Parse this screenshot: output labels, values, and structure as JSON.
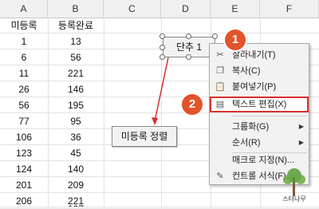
{
  "columns": [
    "A",
    "B",
    "C",
    "D",
    "E",
    "F"
  ],
  "rows": [
    {
      "a": "미등록",
      "b": "등록완료"
    },
    {
      "a": "1",
      "b": "13"
    },
    {
      "a": "6",
      "b": "56"
    },
    {
      "a": "11",
      "b": "221"
    },
    {
      "a": "26",
      "b": "146"
    },
    {
      "a": "56",
      "b": "195"
    },
    {
      "a": "77",
      "b": "95"
    },
    {
      "a": "106",
      "b": "36"
    },
    {
      "a": "123",
      "b": "45"
    },
    {
      "a": "124",
      "b": "140"
    },
    {
      "a": "201",
      "b": "209"
    },
    {
      "a": "206",
      "b": "221"
    },
    {
      "a": "",
      "b": "107"
    }
  ],
  "shape_button": {
    "label": "단추 1"
  },
  "sort_button": {
    "label": "미등록 정렬"
  },
  "context_menu": {
    "items": [
      {
        "icon": "scissors-icon",
        "label": "잘라내기(T)",
        "has_sub": false
      },
      {
        "icon": "copy-icon",
        "label": "복사(C)",
        "has_sub": false
      },
      {
        "icon": "paste-icon",
        "label": "붙여넣기(P)",
        "has_sub": false
      },
      {
        "icon": "edit-text-icon",
        "label": "텍스트 편집(X)",
        "has_sub": false
      },
      {
        "icon": "",
        "label": "그룹화(G)",
        "has_sub": true
      },
      {
        "icon": "",
        "label": "순서(R)",
        "has_sub": true
      },
      {
        "icon": "",
        "label": "매크로 지정(N)...",
        "has_sub": false
      },
      {
        "icon": "format-control-icon",
        "label": "컨트롤 서식(F)...",
        "has_sub": false
      }
    ]
  },
  "badges": [
    "1",
    "2"
  ],
  "watermark": {
    "text": "스터나무"
  },
  "colors": {
    "highlight": "#d9302c",
    "badge": "#e2532a",
    "arrow": "#d9302c"
  }
}
